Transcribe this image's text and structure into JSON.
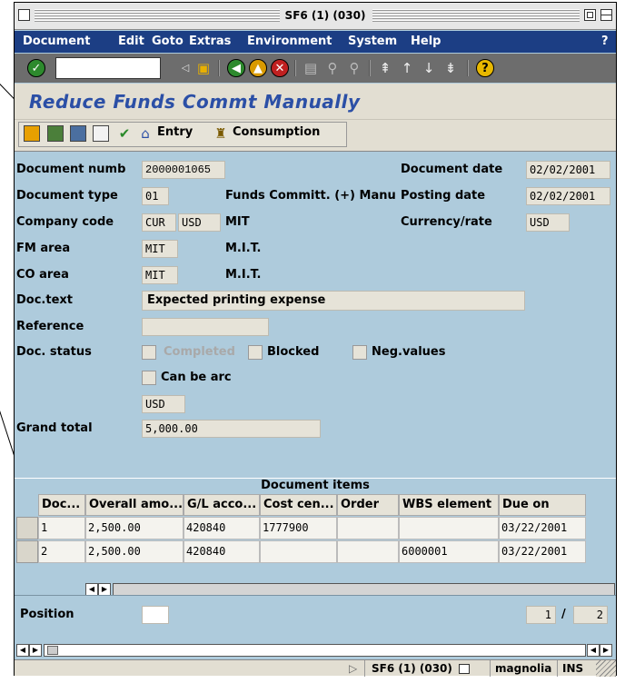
{
  "window": {
    "title": "SF6 (1) (030)"
  },
  "menu": {
    "items": [
      "Document",
      "Edit",
      "Goto",
      "Extras",
      "Environment",
      "System",
      "Help"
    ],
    "help_q": "?"
  },
  "app": {
    "title": "Reduce Funds Commt Manually"
  },
  "app_toolbar": {
    "entry_label": "Entry",
    "consumption_label": "Consumption"
  },
  "header": {
    "doc_number_label": "Document numb",
    "doc_number": "2000001065",
    "doc_date_label": "Document date",
    "doc_date": "02/02/2001",
    "doc_type_label": "Document type",
    "doc_type": "01",
    "doc_type_desc": "Funds Committ. (+) Manu",
    "posting_date_label": "Posting date",
    "posting_date": "02/02/2001",
    "company_code_label": "Company code",
    "company_code": "CUR",
    "company_currency": "USD",
    "company_name": "MIT",
    "currency_rate_label": "Currency/rate",
    "currency": "USD",
    "fm_area_label": "FM area",
    "fm_area": "MIT",
    "fm_area_name": "M.I.T.",
    "co_area_label": "CO area",
    "co_area": "MIT",
    "co_area_name": "M.I.T.",
    "doc_text_label": "Doc.text",
    "doc_text": "Expected printing expense",
    "reference_label": "Reference",
    "reference": "",
    "doc_status_label": "Doc. status",
    "completed_label": "Completed",
    "blocked_label": "Blocked",
    "negvalues_label": "Neg.values",
    "can_be_arc_label": "Can be arc",
    "total_currency": "USD",
    "grand_total_label": "Grand total",
    "grand_total": "5,000.00"
  },
  "items": {
    "title": "Document items",
    "columns": [
      "Doc...",
      "Overall amo...",
      "G/L acco...",
      "Cost cen...",
      "Order",
      "WBS element",
      "Due on"
    ],
    "rows": [
      [
        "1",
        "2,500.00",
        "420840",
        "1777900",
        "",
        "",
        "03/22/2001"
      ],
      [
        "2",
        "2,500.00",
        "420840",
        "",
        "",
        "6000001",
        "03/22/2001"
      ]
    ]
  },
  "position": {
    "label": "Position",
    "value": "",
    "current": "1",
    "slash": "/",
    "total": "2"
  },
  "statusbar": {
    "system": "SF6 (1) (030)",
    "server": "magnolia",
    "mode": "INS"
  }
}
